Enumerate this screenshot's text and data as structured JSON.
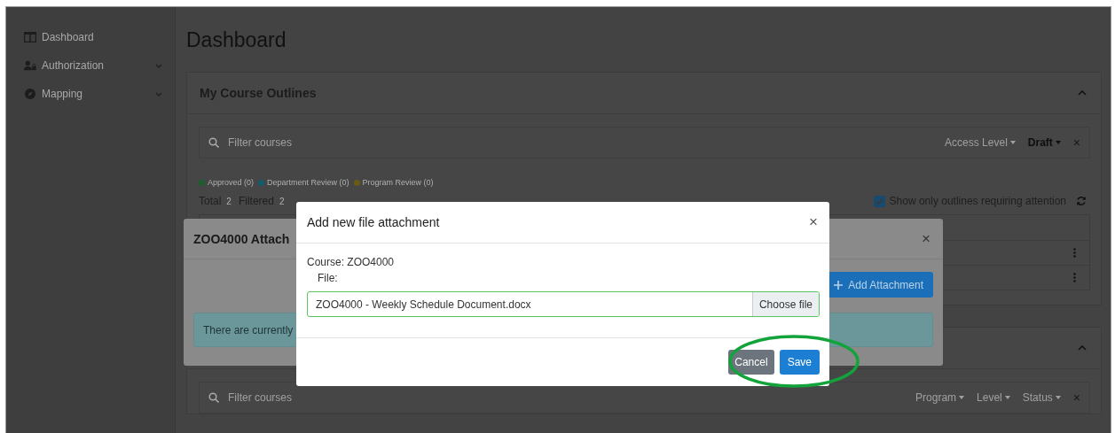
{
  "sidebar": {
    "items": [
      {
        "label": "Dashboard",
        "has_submenu": false
      },
      {
        "label": "Authorization",
        "has_submenu": true
      },
      {
        "label": "Mapping",
        "has_submenu": true
      }
    ]
  },
  "page": {
    "title": "Dashboard"
  },
  "outlines_card": {
    "title": "My Course Outlines",
    "expanded": true,
    "filter": {
      "placeholder": "Filter courses",
      "dropdowns": [
        {
          "label": "Access Level",
          "active": false
        },
        {
          "label": "Draft",
          "active": true
        }
      ],
      "clear": "×"
    },
    "legend": [
      {
        "label": "Approved (0)",
        "color": "#1e5e2c"
      },
      {
        "label": "Department Review (0)",
        "color": "#145b6e"
      },
      {
        "label": "Program Review (0)",
        "color": "#6b5a12"
      }
    ],
    "totals": [
      {
        "label": "Total",
        "count": "2"
      },
      {
        "label": "Filtered",
        "count": "2"
      }
    ],
    "attention_filter": {
      "label": "Show only outlines requiring attention",
      "checked": true
    }
  },
  "second_card": {
    "expanded": true,
    "filter": {
      "placeholder": "Filter courses",
      "dropdowns": [
        {
          "label": "Program",
          "active": false
        },
        {
          "label": "Level",
          "active": false
        },
        {
          "label": "Status",
          "active": false
        }
      ],
      "clear": "×"
    }
  },
  "attachments_modal": {
    "title": "ZOO4000 Attach",
    "close": "×",
    "button": "Add Attachment",
    "alert": "There are currently"
  },
  "file_modal": {
    "title": "Add new file attachment",
    "close": "×",
    "course": "Course: ZOO4000",
    "file_label": "File:",
    "file": {
      "value": "ZOO4000 - Weekly Schedule Document.docx",
      "button": "Choose file"
    },
    "buttons": [
      {
        "label": "Cancel",
        "kind": "secondary"
      },
      {
        "label": "Save",
        "kind": "primary"
      }
    ]
  }
}
